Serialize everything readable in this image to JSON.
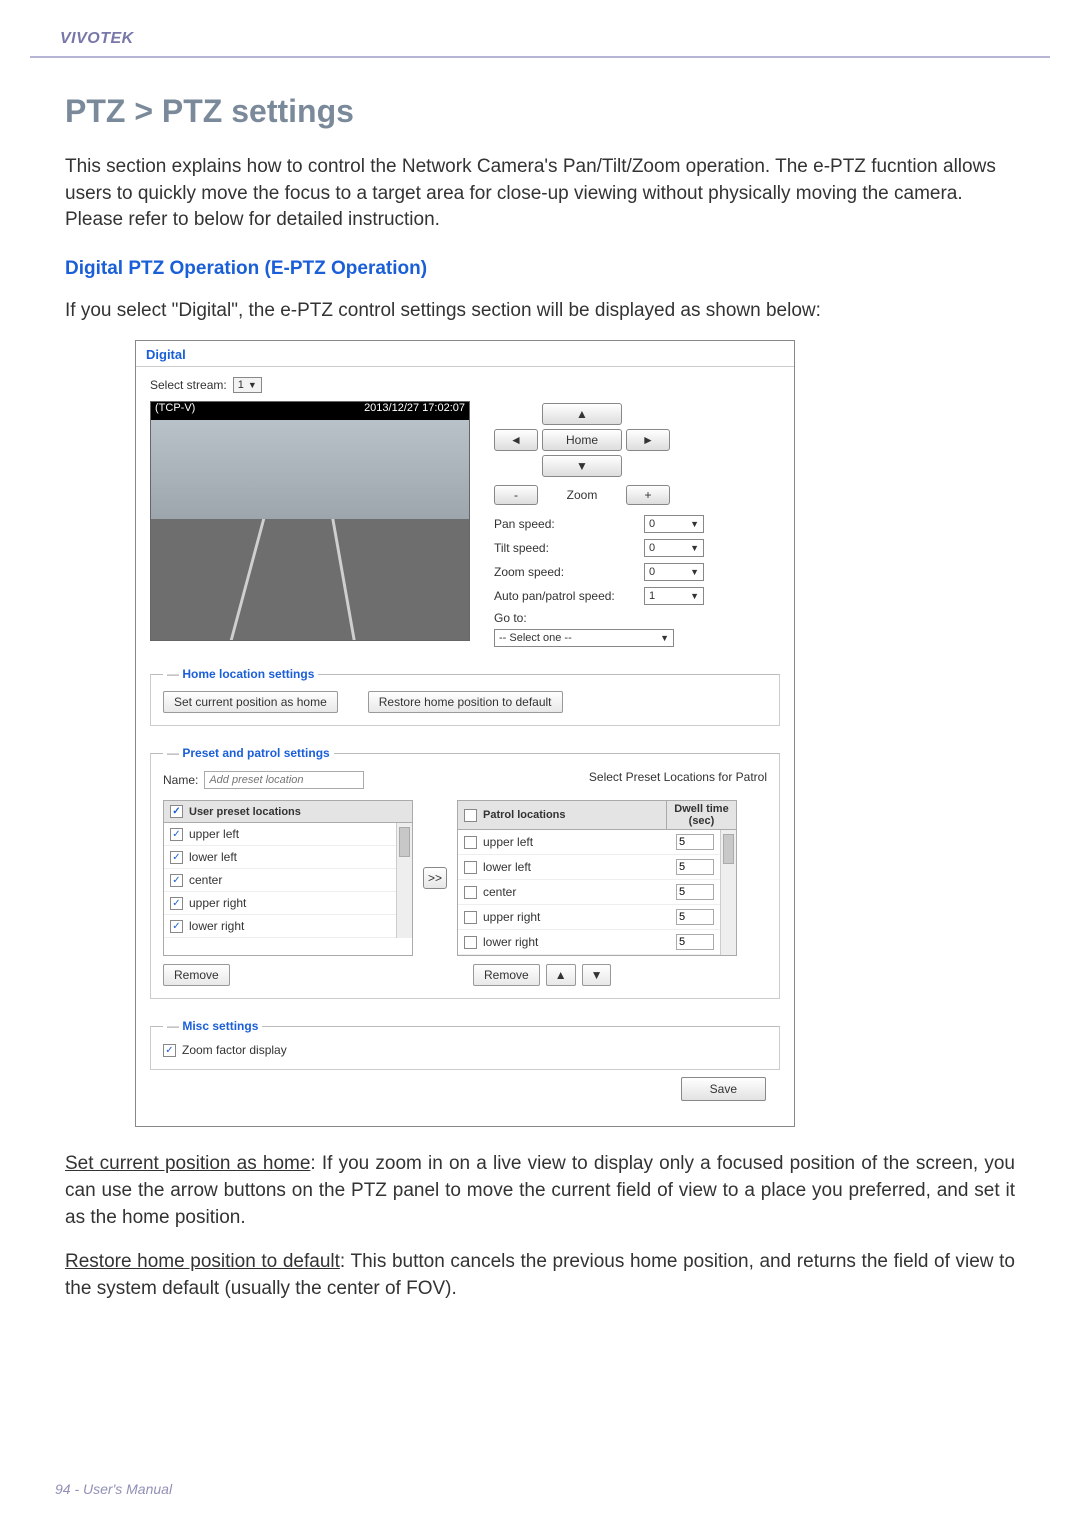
{
  "brand": "VIVOTEK",
  "page_title": "PTZ > PTZ settings",
  "intro": "This section explains how to control the Network Camera's Pan/Tilt/Zoom operation.\nThe e-PTZ fucntion allows users to quickly move the focus to a target area for close-up viewing without physically moving the camera. Please refer to below for detailed instruction.",
  "section_sub": "Digital PTZ Operation (E-PTZ Operation)",
  "lead_in": "If you select \"Digital\", the e-PTZ control settings section will be displayed as shown below:",
  "ss": {
    "tab": "Digital",
    "select_stream_label": "Select stream:",
    "select_stream_value": "1",
    "video_overlay_label": "(TCP-V)",
    "video_timestamp": "2013/12/27 17:02:07",
    "pad": {
      "up": "▲",
      "down": "▼",
      "left": "◄",
      "right": "►",
      "home": "Home"
    },
    "zoom": {
      "minus": "-",
      "label": "Zoom",
      "plus": "+"
    },
    "speeds": {
      "pan_label": "Pan speed:",
      "pan_value": "0",
      "tilt_label": "Tilt speed:",
      "tilt_value": "0",
      "zoom_label": "Zoom speed:",
      "zoom_value": "0",
      "auto_label": "Auto pan/patrol speed:",
      "auto_value": "1"
    },
    "goto_label": "Go to:",
    "goto_value": "-- Select one --",
    "home_fs": {
      "legend": "Home location settings",
      "set_btn": "Set current position as home",
      "restore_btn": "Restore home position to default"
    },
    "preset_fs": {
      "legend": "Preset and patrol settings",
      "name_label": "Name:",
      "name_placeholder": "Add preset location",
      "select_patrol_label": "Select Preset Locations for Patrol",
      "user_header": "User preset locations",
      "patrol_header": "Patrol locations",
      "dwell_header": "Dwell time (sec)",
      "transfer": ">>",
      "remove": "Remove",
      "move_up": "▲",
      "move_down": "▼",
      "presets": [
        {
          "label": "upper left"
        },
        {
          "label": "lower left"
        },
        {
          "label": "center"
        },
        {
          "label": "upper right"
        },
        {
          "label": "lower right"
        }
      ],
      "patrol": [
        {
          "label": "upper left",
          "dwell": "5"
        },
        {
          "label": "lower left",
          "dwell": "5"
        },
        {
          "label": "center",
          "dwell": "5"
        },
        {
          "label": "upper right",
          "dwell": "5"
        },
        {
          "label": "lower right",
          "dwell": "5"
        }
      ]
    },
    "misc_fs": {
      "legend": "Misc settings",
      "zoom_factor": "Zoom factor display"
    },
    "save": "Save"
  },
  "explain1_u": "Set current position as home",
  "explain1_rest": ": If you zoom in on a live view to display only a focused position of the screen, you can use the arrow buttons on the PTZ panel to move the current field of view to a place you preferred, and set it as the home position.",
  "explain2_u": "Restore home position to default",
  "explain2_rest": ": This button cancels the previous home position, and returns the field of view to the system default (usually the center of FOV).",
  "footer": "94 - User's Manual"
}
